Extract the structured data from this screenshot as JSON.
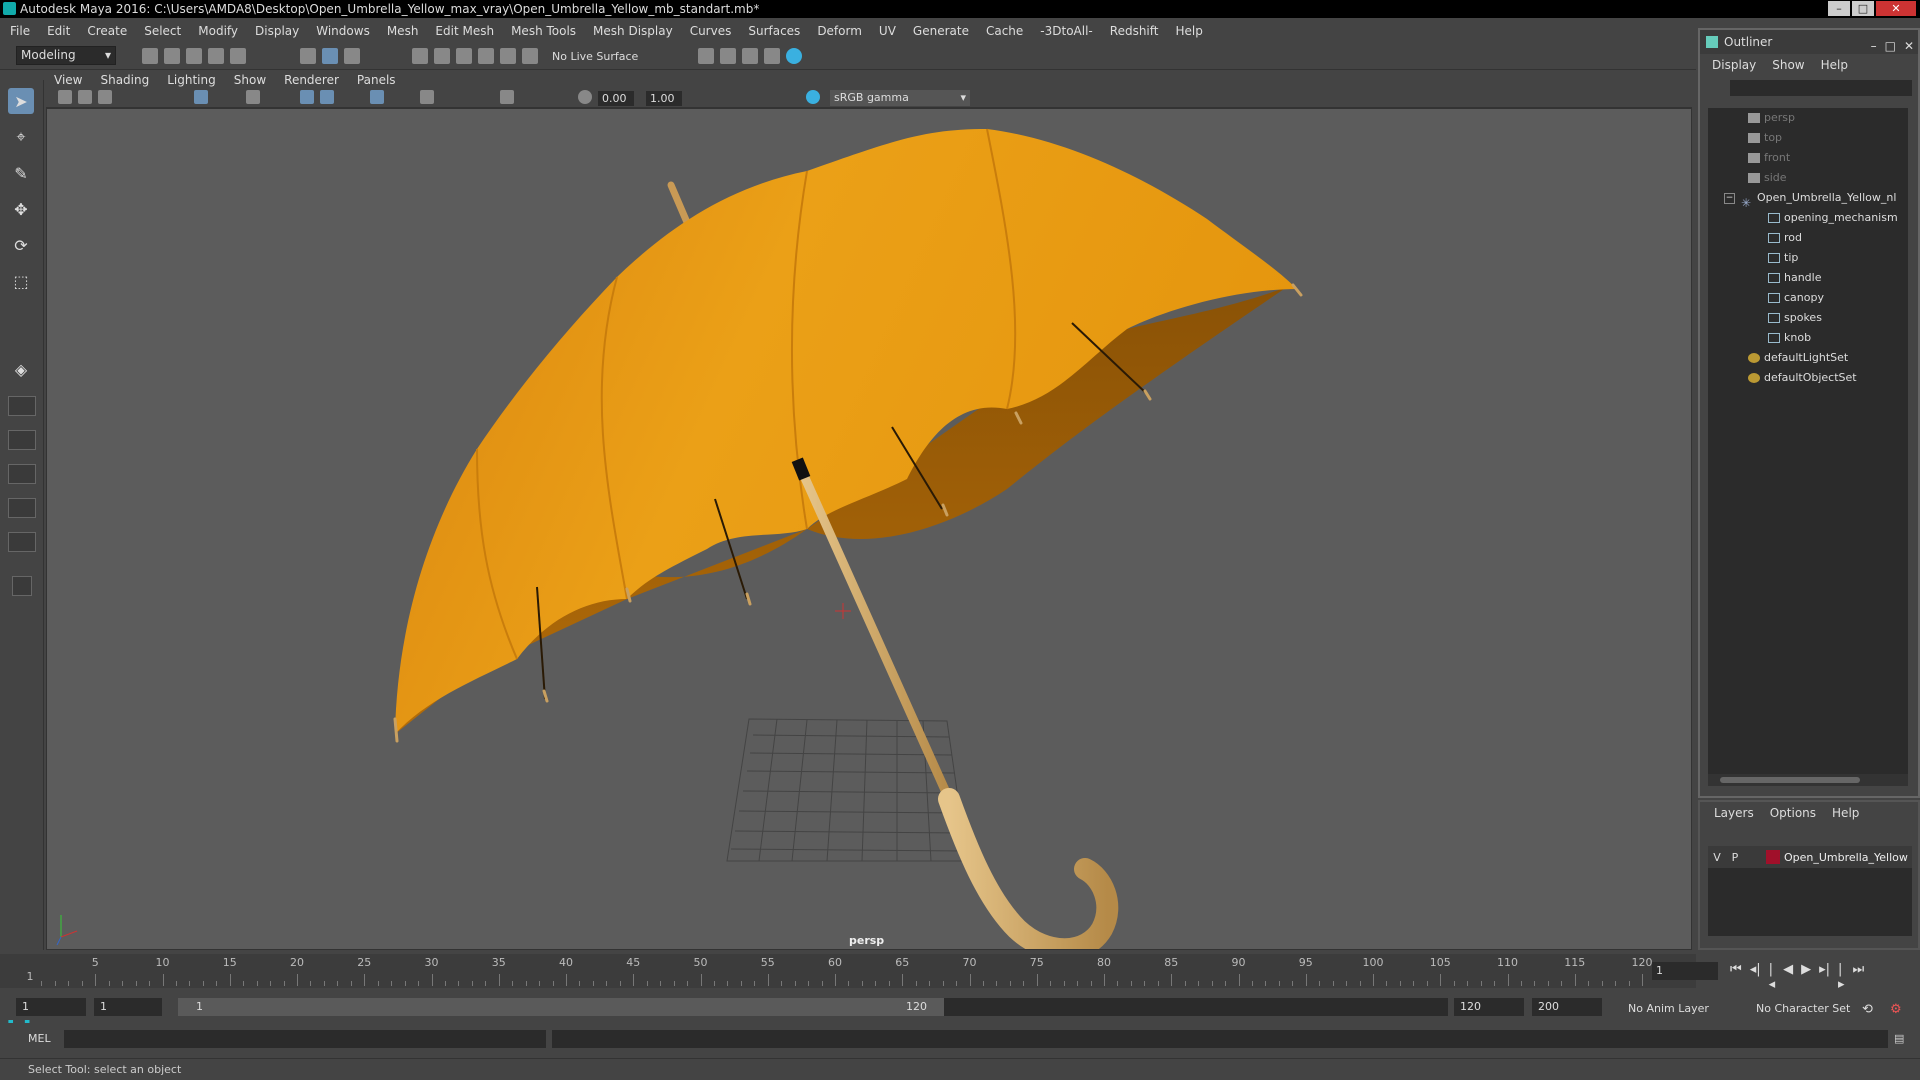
{
  "window": {
    "title": "Autodesk Maya 2016: C:\\Users\\AMDA8\\Desktop\\Open_Umbrella_Yellow_max_vray\\Open_Umbrella_Yellow_mb_standart.mb*"
  },
  "menubar": {
    "items": [
      "File",
      "Edit",
      "Create",
      "Select",
      "Modify",
      "Display",
      "Windows",
      "Mesh",
      "Edit Mesh",
      "Mesh Tools",
      "Mesh Display",
      "Curves",
      "Surfaces",
      "Deform",
      "UV",
      "Generate",
      "Cache",
      "-3DtoAll-",
      "Redshift",
      "Help"
    ]
  },
  "shelf": {
    "mode": "Modeling",
    "live_surface": "No Live Surface"
  },
  "viewport": {
    "menu": [
      "View",
      "Shading",
      "Lighting",
      "Show",
      "Renderer",
      "Panels"
    ],
    "exposure": "0.00",
    "gamma": "1.00",
    "color_space": "sRGB gamma",
    "camera": "persp"
  },
  "outliner": {
    "title": "Outliner",
    "menu": [
      "Display",
      "Show",
      "Help"
    ],
    "items": [
      {
        "label": "persp",
        "type": "camera",
        "dim": true
      },
      {
        "label": "top",
        "type": "camera",
        "dim": true
      },
      {
        "label": "front",
        "type": "camera",
        "dim": true
      },
      {
        "label": "side",
        "type": "camera",
        "dim": true
      },
      {
        "label": "Open_Umbrella_Yellow_nl",
        "type": "group",
        "dim": false
      },
      {
        "label": "opening_mechanism",
        "type": "mesh",
        "dim": false
      },
      {
        "label": "rod",
        "type": "mesh",
        "dim": false
      },
      {
        "label": "tip",
        "type": "mesh",
        "dim": false
      },
      {
        "label": "handle",
        "type": "mesh",
        "dim": false
      },
      {
        "label": "canopy",
        "type": "mesh",
        "dim": false
      },
      {
        "label": "spokes",
        "type": "mesh",
        "dim": false
      },
      {
        "label": "knob",
        "type": "mesh",
        "dim": false
      },
      {
        "label": "defaultLightSet",
        "type": "set",
        "dim": false
      },
      {
        "label": "defaultObjectSet",
        "type": "set",
        "dim": false
      }
    ]
  },
  "layers": {
    "menu": [
      "Layers",
      "Options",
      "Help"
    ],
    "row": {
      "v": "V",
      "p": "P",
      "name": "Open_Umbrella_Yellow",
      "color": "#a0102a"
    }
  },
  "timeline": {
    "ticks": [
      "5",
      "10",
      "15",
      "20",
      "25",
      "30",
      "35",
      "40",
      "45",
      "50",
      "55",
      "60",
      "65",
      "70",
      "75",
      "80",
      "85",
      "90",
      "95",
      "100",
      "105",
      "110",
      "115",
      "120"
    ],
    "start_marker": "1",
    "current_frame": "1"
  },
  "range": {
    "start": "1",
    "playback_start": "1",
    "slider_start": "1",
    "slider_end": "120",
    "playback_end": "120",
    "end": "200",
    "anim_layer": "No Anim Layer",
    "char_set": "No Character Set"
  },
  "mel": {
    "label": "MEL"
  },
  "status": {
    "text": "Select Tool: select an object"
  },
  "colors": {
    "canopy": "#e8960f",
    "handle": "#d2aa6a",
    "viewport_bg": "#5c5c5c"
  }
}
